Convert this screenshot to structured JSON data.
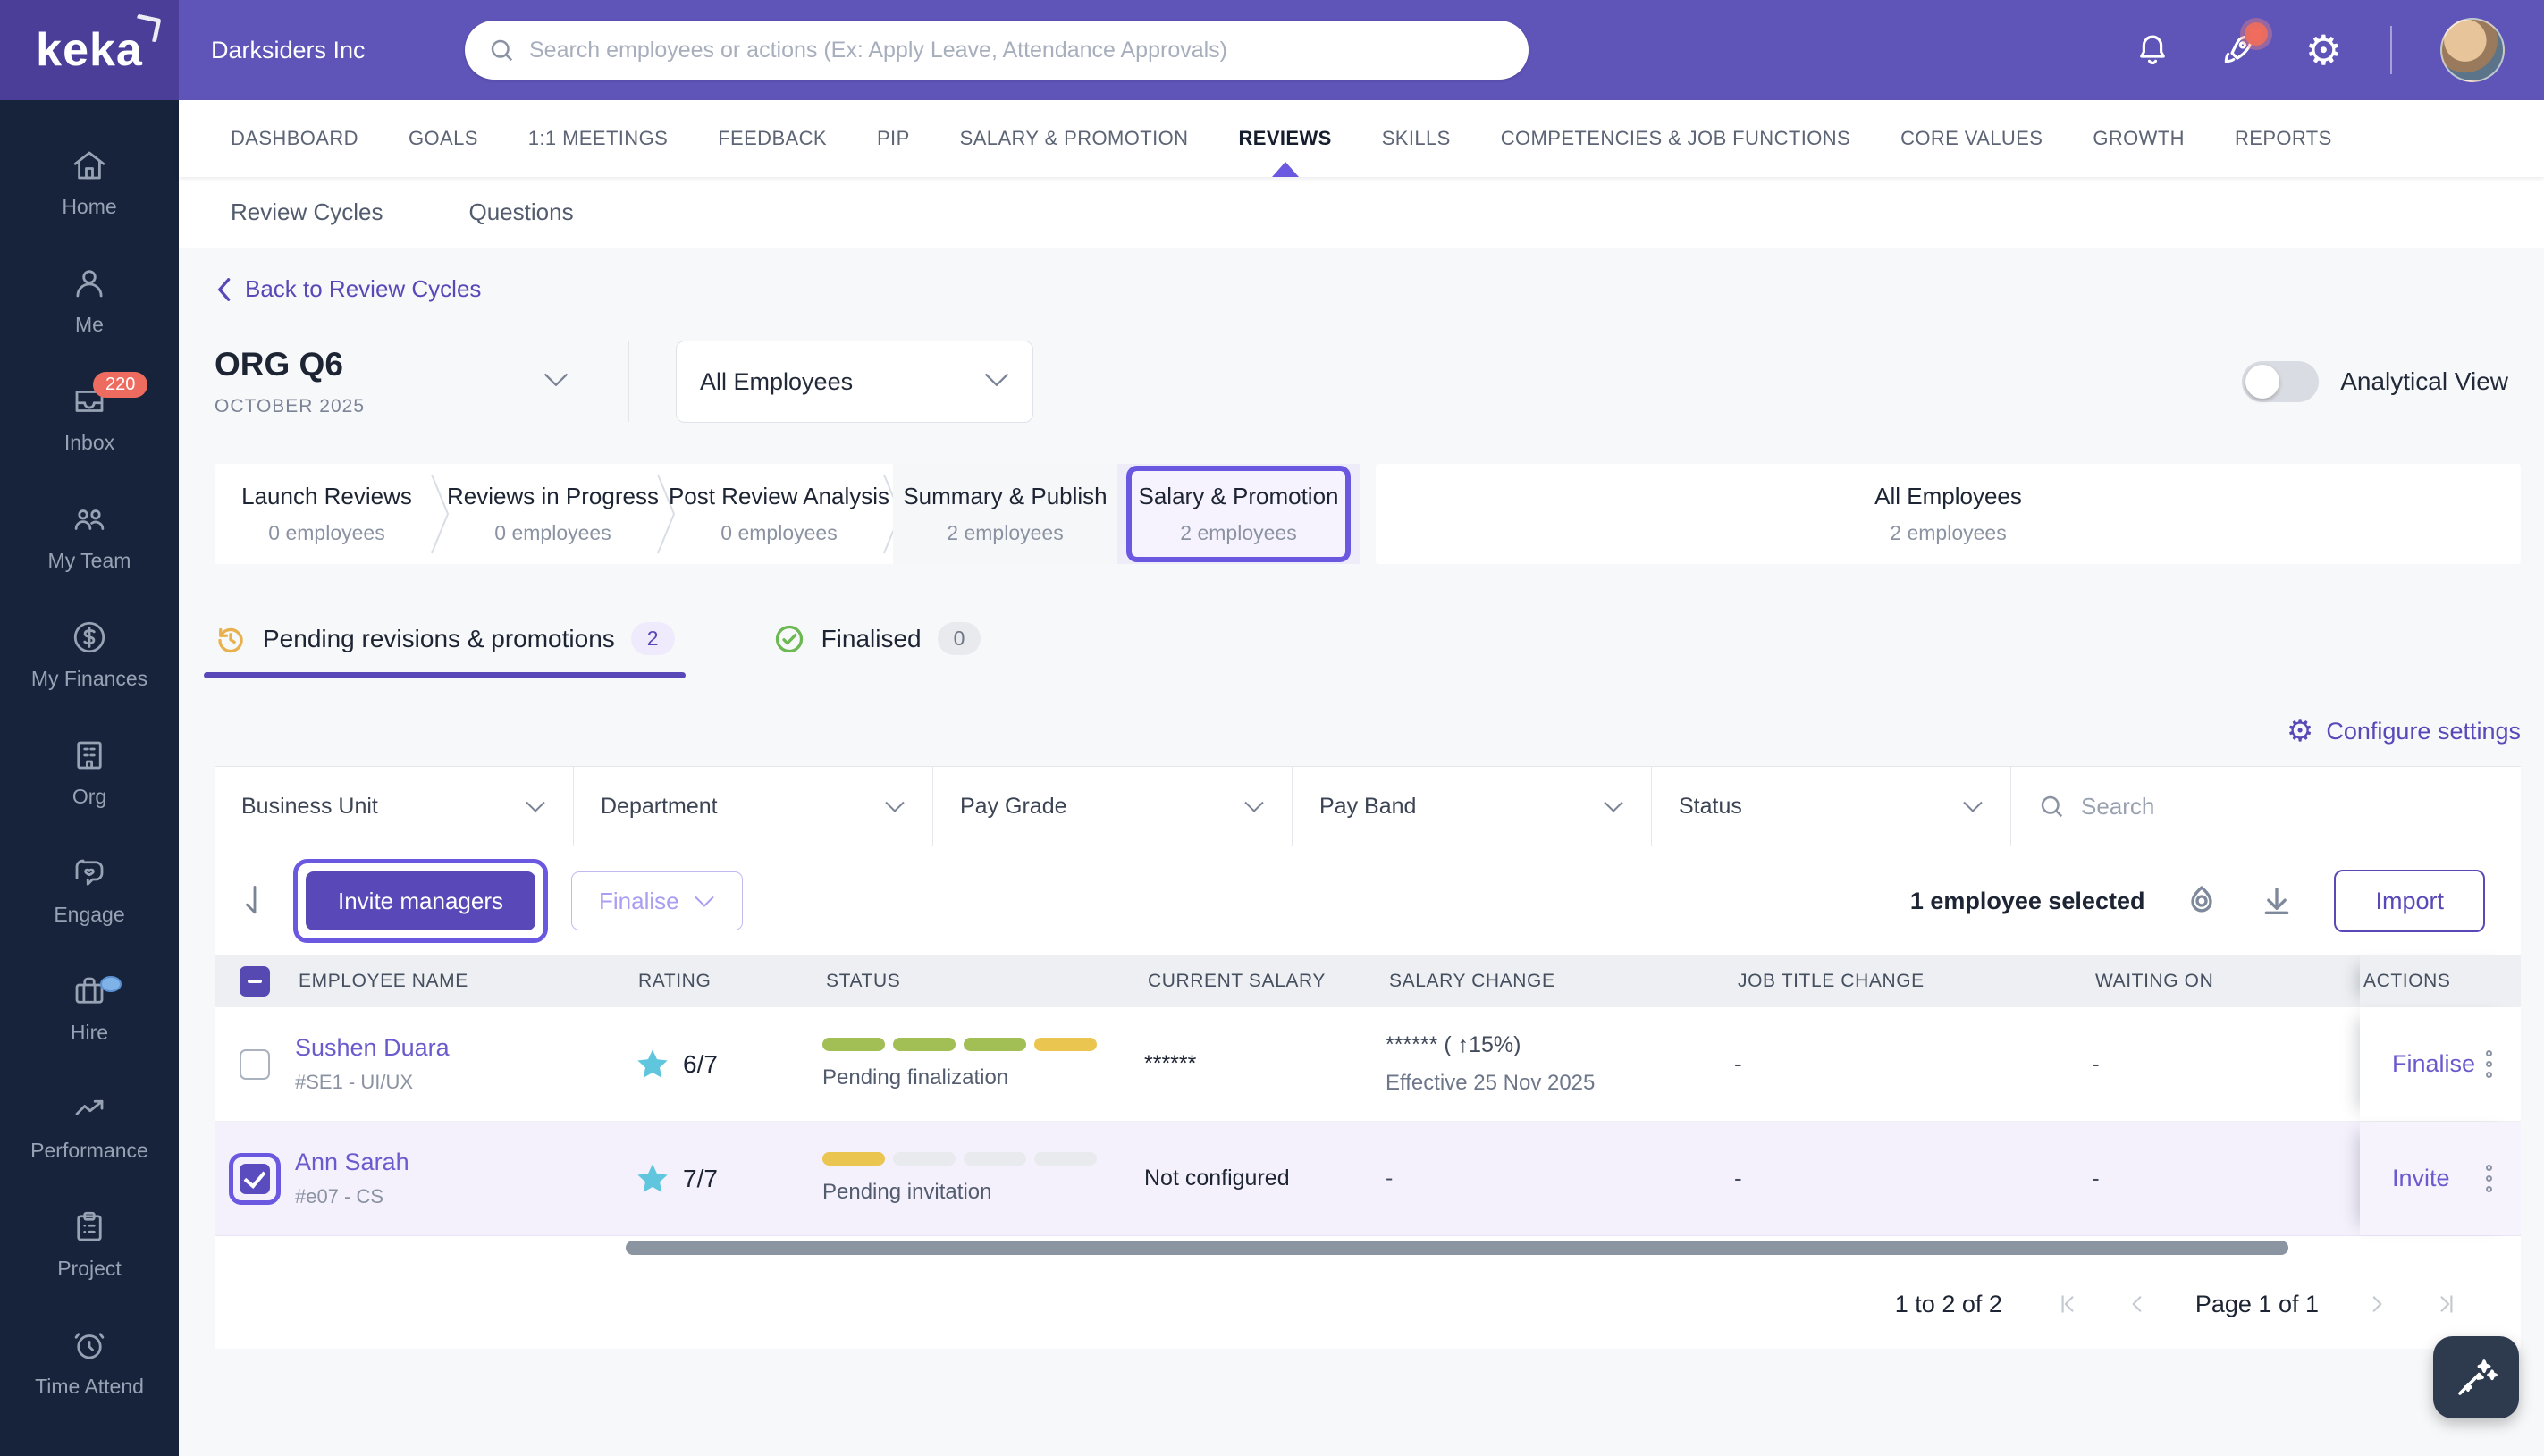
{
  "colors": {
    "accent": "#5948b8",
    "topbar": "#5f54b8",
    "logo-bg": "#4b3e99",
    "sidebar-bg": "#16233a",
    "badge-red": "#ee6b60",
    "pill-green": "#a2bf56",
    "pill-yellow": "#eac54f",
    "star": "#5fc6de",
    "row-selected": "#f4f1fc",
    "ring": "#6a58e0"
  },
  "brand": {
    "logo": "keka",
    "company": "Darksiders Inc"
  },
  "topbar": {
    "search_placeholder": "Search employees or actions (Ex: Apply Leave, Attendance Approvals)"
  },
  "sidebar": {
    "items": [
      {
        "label": "Home"
      },
      {
        "label": "Me"
      },
      {
        "label": "Inbox",
        "badge": "220"
      },
      {
        "label": "My Team"
      },
      {
        "label": "My Finances"
      },
      {
        "label": "Org"
      },
      {
        "label": "Engage"
      },
      {
        "label": "Hire"
      },
      {
        "label": "Performance"
      },
      {
        "label": "Project"
      },
      {
        "label": "Time Attend"
      }
    ]
  },
  "nav": {
    "tabs": [
      {
        "label": "DASHBOARD"
      },
      {
        "label": "GOALS"
      },
      {
        "label": "1:1 MEETINGS"
      },
      {
        "label": "FEEDBACK"
      },
      {
        "label": "PIP"
      },
      {
        "label": "SALARY & PROMOTION"
      },
      {
        "label": "REVIEWS",
        "active": true
      },
      {
        "label": "SKILLS"
      },
      {
        "label": "COMPETENCIES & JOB FUNCTIONS"
      },
      {
        "label": "CORE VALUES"
      },
      {
        "label": "GROWTH"
      },
      {
        "label": "REPORTS"
      }
    ]
  },
  "subnav": {
    "tab1": "Review Cycles",
    "tab2": "Questions"
  },
  "page": {
    "back_link": "Back to Review Cycles",
    "cycle_name": "ORG Q6",
    "cycle_period": "OCTOBER 2025",
    "employee_filter": "All Employees",
    "analytical_view": "Analytical View",
    "configure_settings": "Configure settings",
    "stages": [
      {
        "name": "Launch Reviews",
        "count": "0 employees"
      },
      {
        "name": "Reviews in Progress",
        "count": "0 employees"
      },
      {
        "name": "Post Review Analysis",
        "count": "0 employees"
      },
      {
        "name": "Summary & Publish",
        "count": "2 employees"
      },
      {
        "name": "Salary & Promotion",
        "count": "2 employees"
      },
      {
        "name": "All Employees",
        "count": "2 employees"
      }
    ],
    "tabs": [
      {
        "label": "Pending revisions & promotions",
        "count": "2"
      },
      {
        "label": "Finalised",
        "count": "0"
      }
    ]
  },
  "filters": {
    "dropdowns": [
      {
        "label": "Business Unit"
      },
      {
        "label": "Department"
      },
      {
        "label": "Pay Grade"
      },
      {
        "label": "Pay Band"
      },
      {
        "label": "Status"
      }
    ],
    "search_placeholder": "Search"
  },
  "actions": {
    "invite_managers": "Invite managers",
    "finalise": "Finalise",
    "selected_text": "1 employee selected",
    "import": "Import"
  },
  "table": {
    "columns": {
      "name": "EMPLOYEE NAME",
      "rating": "RATING",
      "status": "STATUS",
      "current_salary": "CURRENT SALARY",
      "salary_change": "SALARY CHANGE",
      "job_title_change": "JOB TITLE CHANGE",
      "waiting_on": "WAITING ON",
      "actions": "ACTIONS"
    },
    "rows": [
      {
        "name": "Sushen Duara",
        "id": "#SE1 - UI/UX",
        "rating": "6/7",
        "status_pills": [
          "green",
          "green",
          "green",
          "yellow"
        ],
        "status_text": "Pending finalization",
        "current_salary": "******",
        "salary_change_1": "****** ( ↑15%)",
        "salary_change_2": "Effective 25 Nov 2025",
        "job_title_change": "-",
        "waiting_on": "-",
        "action": "Finalise"
      },
      {
        "name": "Ann Sarah",
        "id": "#e07 - CS",
        "rating": "7/7",
        "status_pills": [
          "yellow",
          "grey",
          "grey",
          "grey"
        ],
        "status_text": "Pending invitation",
        "current_salary": "Not configured",
        "salary_change_1": "-",
        "salary_change_2": "",
        "job_title_change": "-",
        "waiting_on": "-",
        "action": "Invite"
      }
    ],
    "pagination": {
      "range": "1 to 2 of 2",
      "page": "Page 1 of 1"
    }
  }
}
